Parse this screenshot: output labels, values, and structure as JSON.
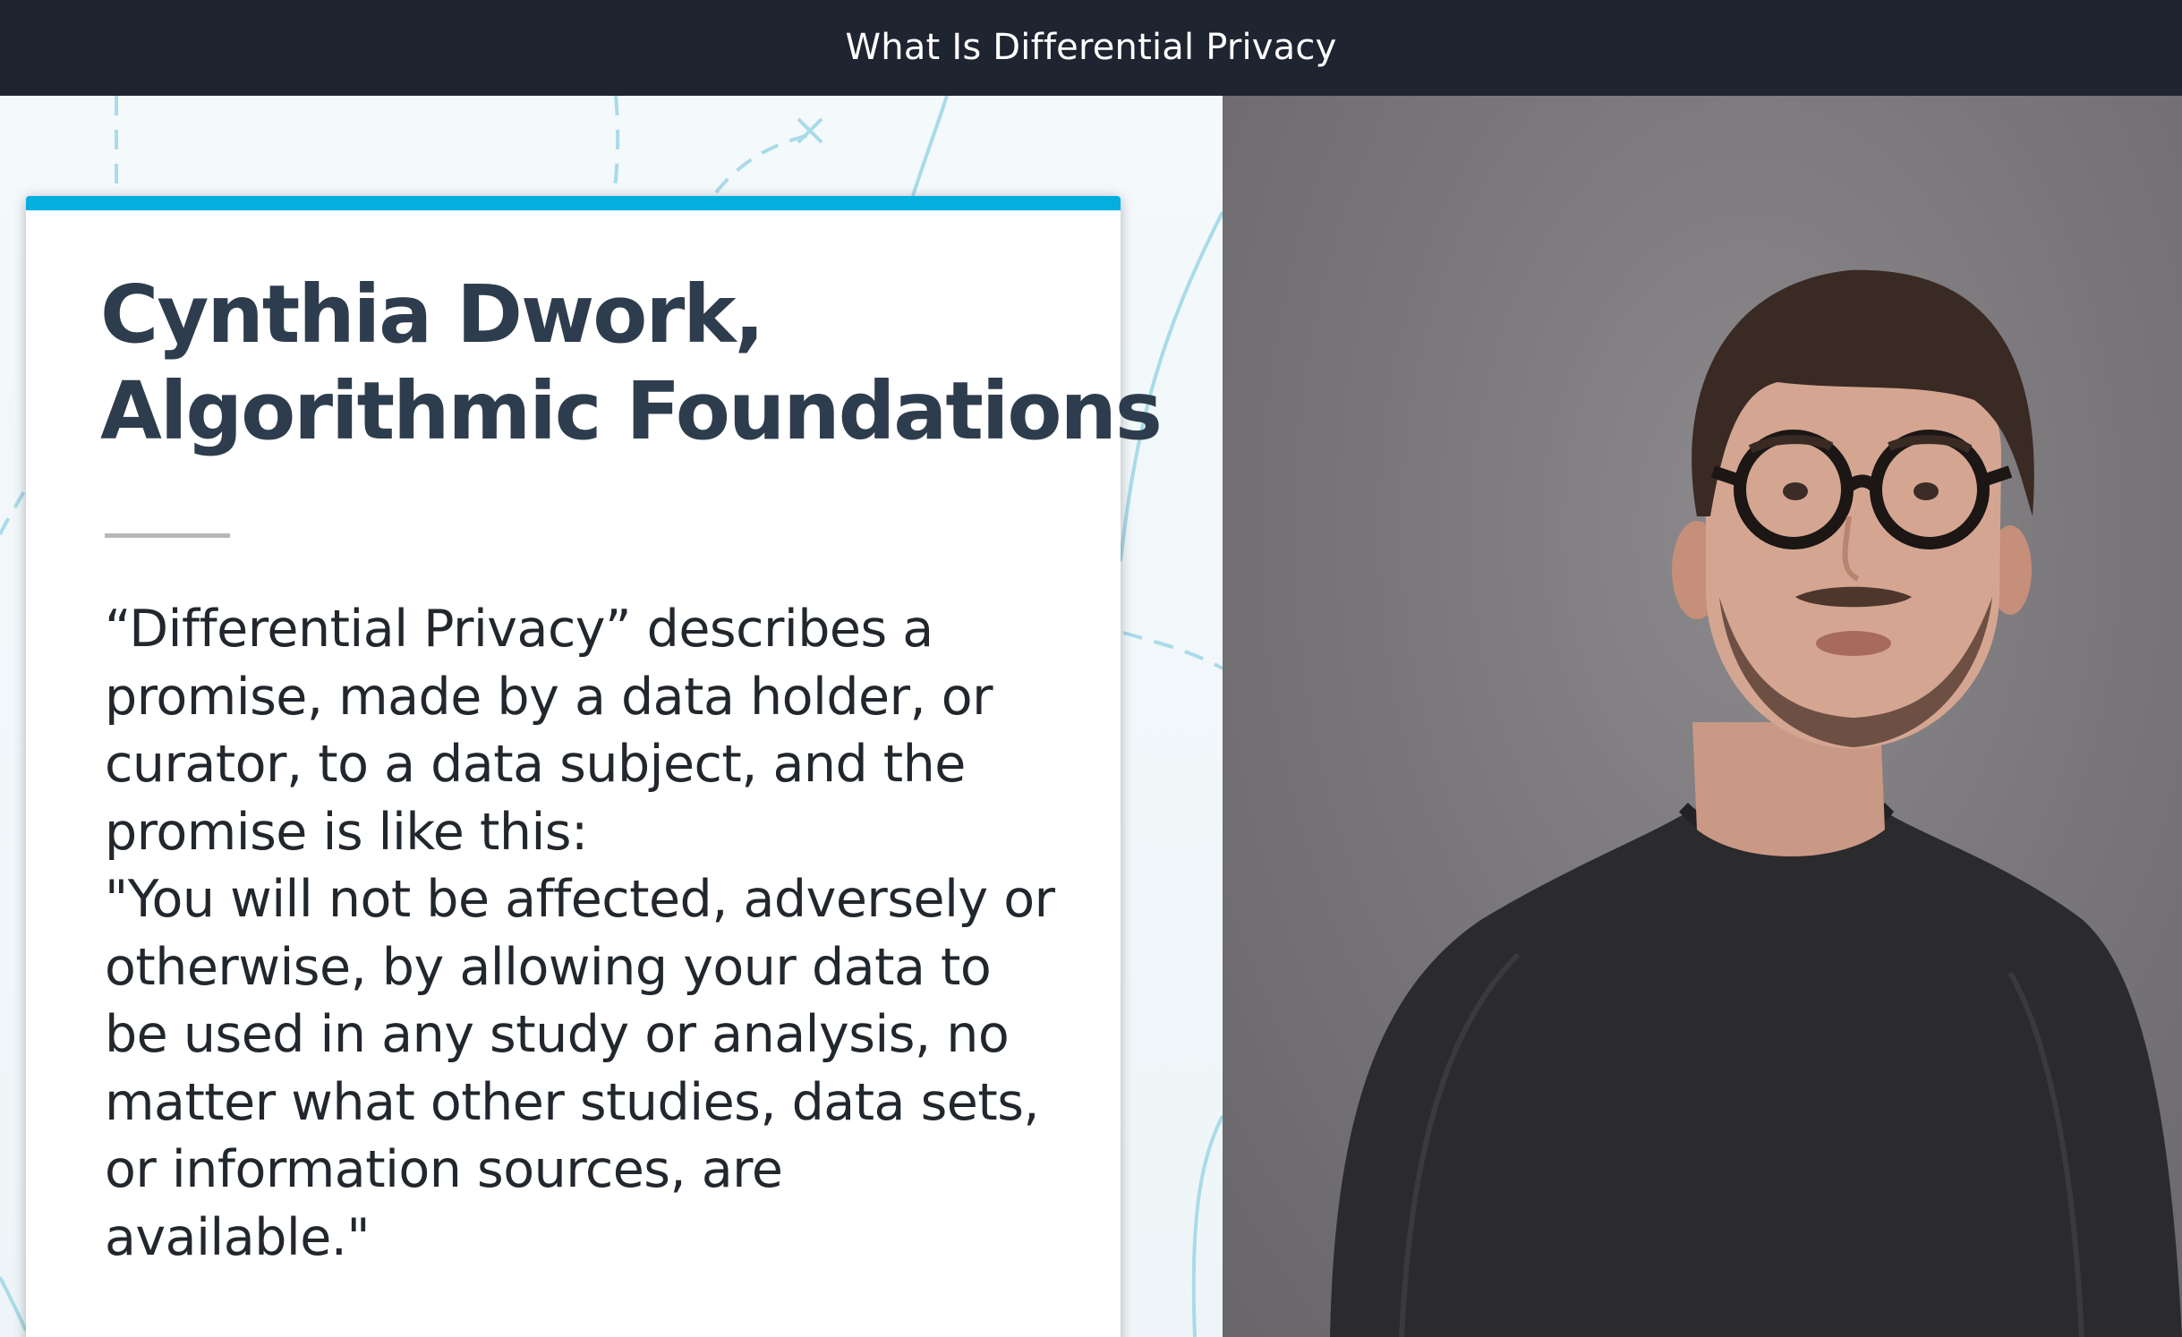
{
  "header": {
    "title": "What Is Differential Privacy"
  },
  "slide": {
    "title_lines": [
      "Cynthia Dwork,",
      "Algorithmic Foundations"
    ],
    "quote_lines": [
      "“Differential Privacy” describes a",
      "promise, made by a data holder, or",
      "curator, to a data subject, and the",
      "promise is like this:",
      "\"You will not be affected, adversely or",
      "otherwise, by allowing your data to",
      "be used in any study or analysis, no",
      "matter what other studies, data sets,",
      "or information sources, are",
      "available.\""
    ]
  },
  "colors": {
    "topbar": "#1f2530",
    "accent": "#04aede",
    "title_text": "#2e3d4d",
    "body_text": "#22272d",
    "backdrop": "#7a787b"
  },
  "icons": [
    "presenter-video-image"
  ]
}
